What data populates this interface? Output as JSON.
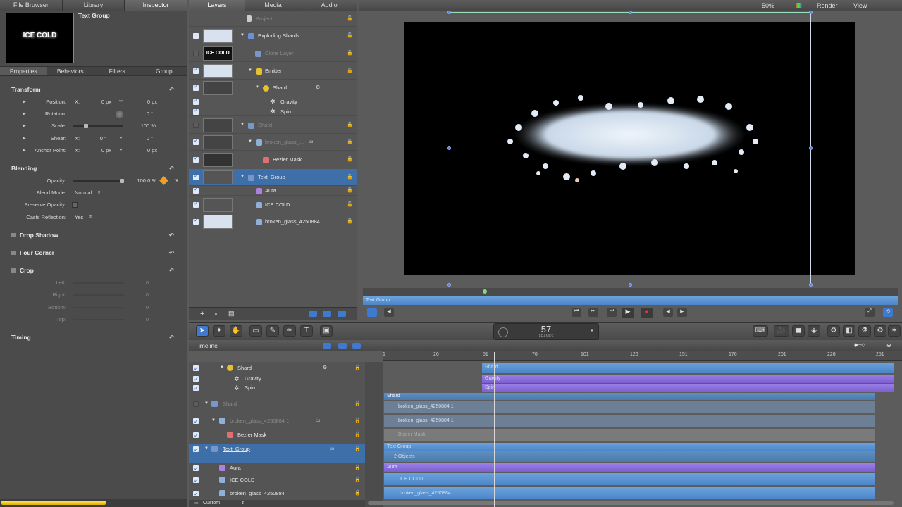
{
  "inspector": {
    "tabs": [
      "File Browser",
      "Library",
      "Inspector"
    ],
    "thumb_title": "Text Group",
    "thumb_text": "ICE COLD",
    "subtabs": [
      "Properties",
      "Behaviors",
      "Filters",
      "Group"
    ],
    "transform": {
      "title": "Transform",
      "rows": [
        {
          "label": "Position:",
          "x_label": "X:",
          "x": "0 px",
          "y_label": "Y:",
          "y": "0 px"
        },
        {
          "label": "Rotation:",
          "value": "0 °"
        },
        {
          "label": "Scale:",
          "value": "100 %"
        },
        {
          "label": "Shear:",
          "x_label": "X:",
          "x": "0 °",
          "y_label": "Y:",
          "y": "0 °"
        },
        {
          "label": "Anchor Point:",
          "x_label": "X:",
          "x": "0 px",
          "y_label": "Y:",
          "y": "0 px"
        }
      ]
    },
    "blending": {
      "title": "Blending",
      "opacity_label": "Opacity:",
      "opacity": "100.0 %",
      "blend_mode_label": "Blend Mode:",
      "blend_mode": "Normal",
      "preserve_opacity_label": "Preserve Opacity:",
      "casts_reflection_label": "Casts Reflection:",
      "casts_reflection": "Yes"
    },
    "sections": [
      "Drop Shadow",
      "Four Corner",
      "Crop",
      "Timing"
    ],
    "crop": {
      "rows": [
        {
          "label": "Left:",
          "value": "0"
        },
        {
          "label": "Right:",
          "value": "0"
        },
        {
          "label": "Bottom:",
          "value": "0"
        },
        {
          "label": "Top:",
          "value": "0"
        }
      ]
    }
  },
  "layers": {
    "tabs": [
      "Layers",
      "Media",
      "Audio"
    ],
    "project": "Project",
    "rows": [
      {
        "name": "Exploding Shards"
      },
      {
        "name": "Clone Layer"
      },
      {
        "name": "Emitter"
      },
      {
        "name": "Shard"
      },
      {
        "name": "Gravity"
      },
      {
        "name": "Spin"
      },
      {
        "name": "Shard"
      },
      {
        "name": "broken_glass_..."
      },
      {
        "name": "Bezier Mask"
      },
      {
        "name": "Text_Group"
      },
      {
        "name": "Aura"
      },
      {
        "name": "ICE COLD"
      },
      {
        "name": "broken_glass_4250884"
      }
    ],
    "thumb_text": "ICE COLD"
  },
  "viewer": {
    "zoom": "50%",
    "render_menu": "Render",
    "view_menu": "View",
    "play_range_label": "Text Group"
  },
  "toolbar": {
    "frame": "57",
    "frame_unit": "FRAMES"
  },
  "timeline": {
    "title": "Timeline",
    "ruler": [
      "1",
      "26",
      "51",
      "76",
      "101",
      "126",
      "151",
      "176",
      "201",
      "226",
      "251"
    ],
    "rows": [
      {
        "name": "Shard"
      },
      {
        "name": "Gravity"
      },
      {
        "name": "Spin"
      },
      {
        "name": "Shard"
      },
      {
        "name": "broken_glass_4250884 1"
      },
      {
        "name": "Bezier Mask"
      },
      {
        "name": "Text_Group"
      },
      {
        "name": "Aura"
      },
      {
        "name": "ICE COLD"
      },
      {
        "name": "broken_glass_4250884"
      }
    ],
    "bars": {
      "shard": "Shard",
      "gravity": "Gravity",
      "spin": "Spin",
      "shard_group": "Shard",
      "bg1": "broken_glass_4250884 1",
      "bg2": "broken_glass_4250884 1",
      "bezier": "Bezier Mask",
      "text_group": "Text Group",
      "objects": "2 Objects",
      "aura": "Aura",
      "ice": "ICE COLD",
      "bg": "broken_glass_4250884"
    },
    "bottom_menu": "Custom"
  },
  "status": {
    "progress": 0.58
  }
}
